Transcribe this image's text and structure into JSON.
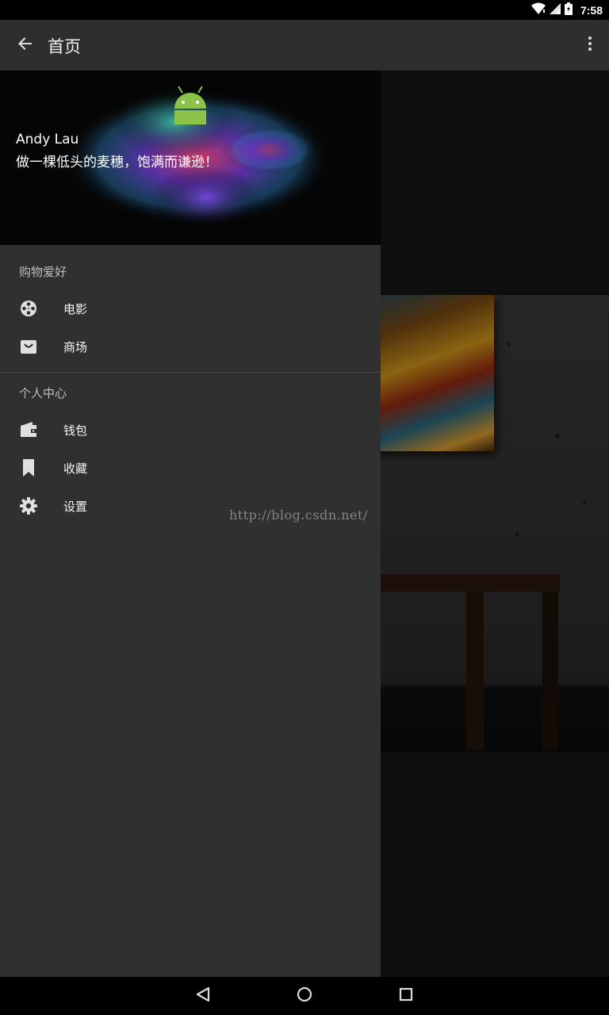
{
  "status_bar": {
    "time": "7:58",
    "icons": [
      "wifi-icon",
      "signal-icon",
      "battery-icon"
    ]
  },
  "app_bar": {
    "title": "首页",
    "back_icon": "arrow-back-icon",
    "overflow_icon": "more-vert-icon"
  },
  "drawer": {
    "header": {
      "name": "Andy Lau",
      "motto": "做一棵低头的麦穗，饱满而谦逊！",
      "image": "android-color-splash"
    },
    "sections": [
      {
        "title": "购物爱好",
        "items": [
          {
            "label": "电影",
            "icon": "movie-reel-icon"
          },
          {
            "label": "商场",
            "icon": "shopping-bag-icon"
          }
        ]
      },
      {
        "title": "个人中心",
        "items": [
          {
            "label": "钱包",
            "icon": "wallet-icon"
          },
          {
            "label": "收藏",
            "icon": "bookmark-icon"
          },
          {
            "label": "设置",
            "icon": "settings-gear-icon"
          }
        ]
      }
    ]
  },
  "watermark": "http://blog.csdn.net/",
  "nav_bar": {
    "buttons": [
      "back-triangle-icon",
      "home-circle-icon",
      "recents-square-icon"
    ]
  },
  "colors": {
    "drawer_bg": "#303030",
    "app_bar_bg": "#2e2e2e",
    "icon_color": "#e0e0e0",
    "android_green": "#8bc34a"
  }
}
